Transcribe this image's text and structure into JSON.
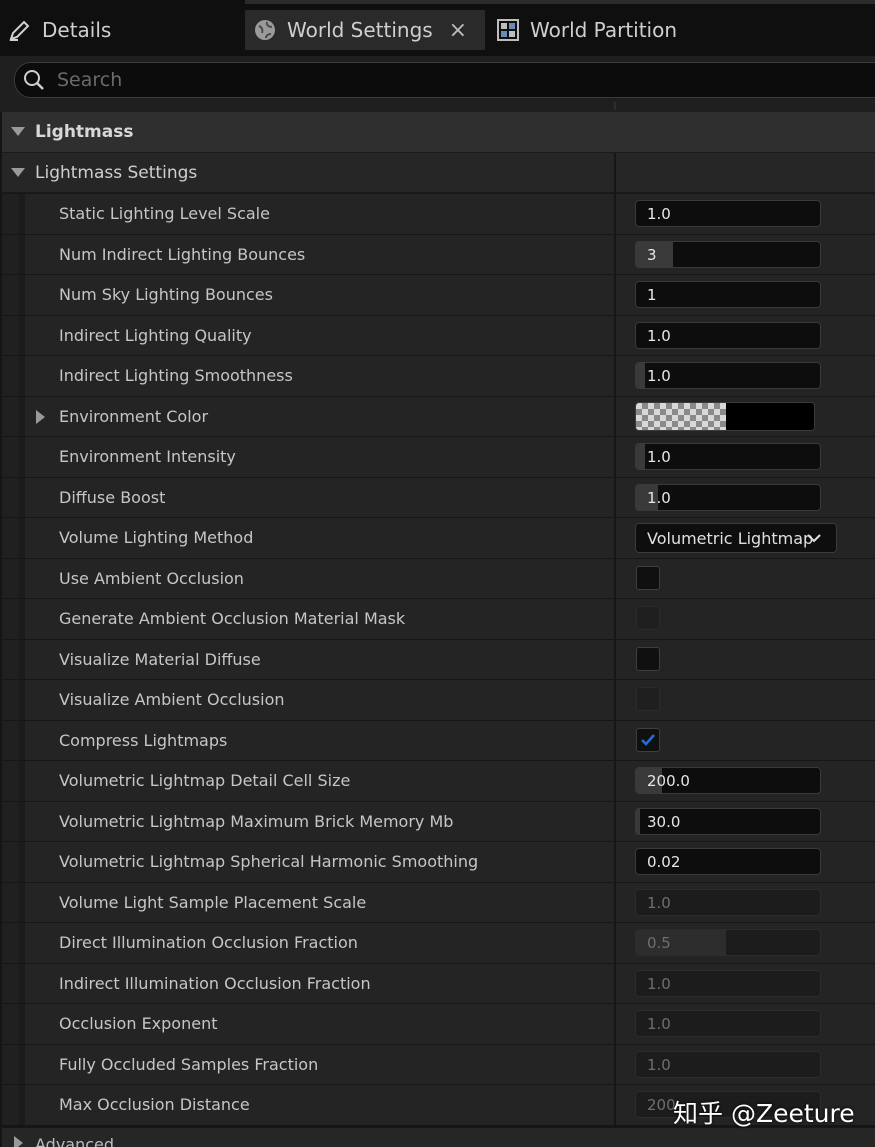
{
  "tabs": [
    {
      "label": "Details",
      "icon": "pencil-icon"
    },
    {
      "label": "World Settings",
      "icon": "globe-icon",
      "close": "×"
    },
    {
      "label": "World Partition",
      "icon": "grid-icon"
    }
  ],
  "search": {
    "placeholder": "Search"
  },
  "category": {
    "label": "Lightmass"
  },
  "subcategory": {
    "label": "Lightmass Settings"
  },
  "rows": [
    {
      "label": "Static Lighting Level Scale",
      "value": "1.0",
      "type": "number",
      "fill_percent": 0
    },
    {
      "label": "Num Indirect Lighting Bounces",
      "value": "3",
      "type": "number",
      "fill_percent": 20
    },
    {
      "label": "Num Sky Lighting Bounces",
      "value": "1",
      "type": "number",
      "fill_percent": 0
    },
    {
      "label": "Indirect Lighting Quality",
      "value": "1.0",
      "type": "number",
      "fill_percent": 0
    },
    {
      "label": "Indirect Lighting Smoothness",
      "value": "1.0",
      "type": "number",
      "fill_percent": 5
    },
    {
      "label": "Environment Color",
      "type": "color",
      "expandable": true
    },
    {
      "label": "Environment Intensity",
      "value": "1.0",
      "type": "number",
      "fill_percent": 5
    },
    {
      "label": "Diffuse Boost",
      "value": "1.0",
      "type": "number",
      "fill_percent": 12
    },
    {
      "label": "Volume Lighting Method",
      "value": "Volumetric Lightmap",
      "type": "dropdown"
    },
    {
      "label": "Use Ambient Occlusion",
      "type": "checkbox",
      "checked": false
    },
    {
      "label": "Generate Ambient Occlusion Material Mask",
      "type": "checkbox",
      "checked": false,
      "disabled": true
    },
    {
      "label": "Visualize Material Diffuse",
      "type": "checkbox",
      "checked": false
    },
    {
      "label": "Visualize Ambient Occlusion",
      "type": "checkbox",
      "checked": false,
      "disabled": true
    },
    {
      "label": "Compress Lightmaps",
      "type": "checkbox",
      "checked": true
    },
    {
      "label": "Volumetric Lightmap Detail Cell Size",
      "value": "200.0",
      "type": "number",
      "fill_percent": 14
    },
    {
      "label": "Volumetric Lightmap Maximum Brick Memory Mb",
      "value": "30.0",
      "type": "number",
      "fill_percent": 2
    },
    {
      "label": "Volumetric Lightmap Spherical Harmonic Smoothing",
      "value": "0.02",
      "type": "number",
      "fill_percent": 0
    },
    {
      "label": "Volume Light Sample Placement Scale",
      "value": "1.0",
      "type": "number",
      "disabled": true,
      "fill_percent": 0
    },
    {
      "label": "Direct Illumination Occlusion Fraction",
      "value": "0.5",
      "type": "number",
      "disabled": true,
      "fill_percent": 49
    },
    {
      "label": "Indirect Illumination Occlusion Fraction",
      "value": "1.0",
      "type": "number",
      "disabled": true,
      "fill_percent": 0
    },
    {
      "label": "Occlusion Exponent",
      "value": "1.0",
      "type": "number",
      "disabled": true,
      "fill_percent": 0
    },
    {
      "label": "Fully Occluded Samples Fraction",
      "value": "1.0",
      "type": "number",
      "disabled": true,
      "fill_percent": 0
    },
    {
      "label": "Max Occlusion Distance",
      "value": "200",
      "type": "number",
      "disabled": true,
      "fill_percent": 0
    }
  ],
  "advanced": {
    "label": "Advanced"
  },
  "watermark": "知乎 @Zeeture",
  "colors": {
    "accent": "#1d6fd6",
    "panel": "#242424",
    "input": "#0d0d0d"
  }
}
